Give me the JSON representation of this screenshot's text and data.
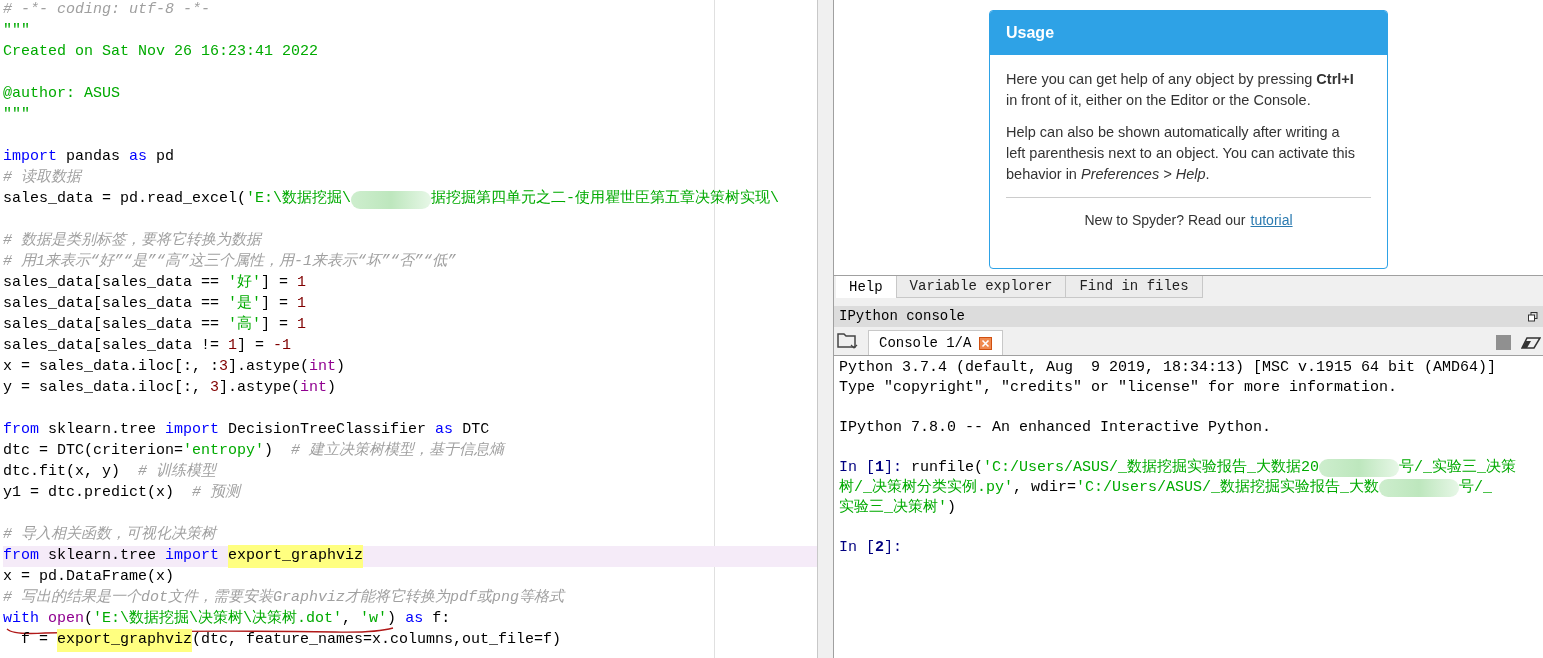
{
  "editor": {
    "lines": [
      {
        "kind": "code",
        "tokens": [
          {
            "kind": "comment",
            "text": "# -*- coding: utf-8 -*-"
          }
        ]
      },
      {
        "kind": "code",
        "tokens": [
          {
            "kind": "str",
            "text": "\"\"\""
          }
        ]
      },
      {
        "kind": "code",
        "tokens": [
          {
            "kind": "str",
            "text": "Created on Sat Nov 26 16:23:41 2022"
          }
        ]
      },
      {
        "kind": "blank"
      },
      {
        "kind": "code",
        "tokens": [
          {
            "kind": "str",
            "text": "@author: ASUS"
          }
        ]
      },
      {
        "kind": "code",
        "tokens": [
          {
            "kind": "str",
            "text": "\"\"\""
          }
        ]
      },
      {
        "kind": "blank"
      },
      {
        "kind": "code",
        "tokens": [
          {
            "kind": "kw",
            "text": "import"
          },
          {
            "kind": "plain",
            "text": " pandas "
          },
          {
            "kind": "kw",
            "text": "as"
          },
          {
            "kind": "plain",
            "text": " pd"
          }
        ]
      },
      {
        "kind": "code",
        "tokens": [
          {
            "kind": "comment",
            "text": "# 读取数据"
          }
        ]
      },
      {
        "kind": "code",
        "tokens": [
          {
            "kind": "plain",
            "text": "sales_data = pd.read_excel("
          },
          {
            "kind": "str",
            "text": "'E:\\数据挖掘\\"
          },
          {
            "kind": "redacted"
          },
          {
            "kind": "str",
            "text": "据挖掘第四单元之二-使用瞿世臣第五章决策树实现\\"
          }
        ]
      },
      {
        "kind": "blank"
      },
      {
        "kind": "code",
        "tokens": [
          {
            "kind": "comment",
            "text": "# 数据是类别标签，要将它转换为数据"
          }
        ]
      },
      {
        "kind": "code",
        "tokens": [
          {
            "kind": "comment",
            "text": "# 用1来表示“好”“是”“高”这三个属性，用-1来表示“坏”“否”“低”"
          }
        ]
      },
      {
        "kind": "code",
        "tokens": [
          {
            "kind": "plain",
            "text": "sales_data[sales_data == "
          },
          {
            "kind": "str",
            "text": "'好'"
          },
          {
            "kind": "plain",
            "text": "] = "
          },
          {
            "kind": "num",
            "text": "1"
          }
        ]
      },
      {
        "kind": "code",
        "tokens": [
          {
            "kind": "plain",
            "text": "sales_data[sales_data == "
          },
          {
            "kind": "str",
            "text": "'是'"
          },
          {
            "kind": "plain",
            "text": "] = "
          },
          {
            "kind": "num",
            "text": "1"
          }
        ]
      },
      {
        "kind": "code",
        "tokens": [
          {
            "kind": "plain",
            "text": "sales_data[sales_data == "
          },
          {
            "kind": "str",
            "text": "'高'"
          },
          {
            "kind": "plain",
            "text": "] = "
          },
          {
            "kind": "num",
            "text": "1"
          }
        ]
      },
      {
        "kind": "code",
        "tokens": [
          {
            "kind": "plain",
            "text": "sales_data[sales_data != "
          },
          {
            "kind": "num",
            "text": "1"
          },
          {
            "kind": "plain",
            "text": "] = "
          },
          {
            "kind": "num",
            "text": "-1"
          }
        ]
      },
      {
        "kind": "code",
        "tokens": [
          {
            "kind": "plain",
            "text": "x = sales_data.iloc[:, :"
          },
          {
            "kind": "num",
            "text": "3"
          },
          {
            "kind": "plain",
            "text": "].astype("
          },
          {
            "kind": "builtin",
            "text": "int"
          },
          {
            "kind": "plain",
            "text": ")"
          }
        ]
      },
      {
        "kind": "code",
        "tokens": [
          {
            "kind": "plain",
            "text": "y = sales_data.iloc[:, "
          },
          {
            "kind": "num",
            "text": "3"
          },
          {
            "kind": "plain",
            "text": "].astype("
          },
          {
            "kind": "builtin",
            "text": "int"
          },
          {
            "kind": "plain",
            "text": ")"
          }
        ]
      },
      {
        "kind": "blank"
      },
      {
        "kind": "code",
        "tokens": [
          {
            "kind": "kw",
            "text": "from"
          },
          {
            "kind": "plain",
            "text": " sklearn.tree "
          },
          {
            "kind": "kw",
            "text": "import"
          },
          {
            "kind": "plain",
            "text": " DecisionTreeClassifier "
          },
          {
            "kind": "kw",
            "text": "as"
          },
          {
            "kind": "plain",
            "text": " DTC"
          }
        ]
      },
      {
        "kind": "code",
        "tokens": [
          {
            "kind": "plain",
            "text": "dtc = DTC(criterion="
          },
          {
            "kind": "str",
            "text": "'entropy'"
          },
          {
            "kind": "plain",
            "text": ")  "
          },
          {
            "kind": "comment",
            "text": "# 建立决策树模型，基于信息熵"
          }
        ]
      },
      {
        "kind": "code",
        "tokens": [
          {
            "kind": "plain",
            "text": "dtc.fit(x, y)  "
          },
          {
            "kind": "comment",
            "text": "# 训练模型"
          }
        ]
      },
      {
        "kind": "code",
        "tokens": [
          {
            "kind": "plain",
            "text": "y1 = dtc.predict(x)  "
          },
          {
            "kind": "comment",
            "text": "# 预测"
          }
        ]
      },
      {
        "kind": "blank"
      },
      {
        "kind": "code",
        "tokens": [
          {
            "kind": "comment",
            "text": "# 导入相关函数，可视化决策树"
          }
        ]
      },
      {
        "kind": "code",
        "current": true,
        "tokens": [
          {
            "kind": "kw",
            "text": "from"
          },
          {
            "kind": "plain",
            "text": " sklearn.tree "
          },
          {
            "kind": "kw",
            "text": "import "
          },
          {
            "kind": "hl",
            "text": "export_graphviz"
          }
        ]
      },
      {
        "kind": "code",
        "tokens": [
          {
            "kind": "plain",
            "text": "x = pd.DataFrame(x)"
          }
        ]
      },
      {
        "kind": "code",
        "tokens": [
          {
            "kind": "comment",
            "text": "# 写出的结果是一个dot文件，需要安装Graphviz才能将它转换为pdf或png等格式"
          }
        ]
      },
      {
        "kind": "code",
        "underlined": true,
        "tokens": [
          {
            "kind": "kw",
            "text": "with "
          },
          {
            "kind": "builtin",
            "text": "open"
          },
          {
            "kind": "plain",
            "text": "("
          },
          {
            "kind": "str",
            "text": "'E:\\数据挖掘\\决策树\\决策树.dot'"
          },
          {
            "kind": "plain",
            "text": ", "
          },
          {
            "kind": "str",
            "text": "'w'"
          },
          {
            "kind": "plain",
            "text": ") "
          },
          {
            "kind": "kw",
            "text": "as"
          },
          {
            "kind": "plain",
            "text": " f:"
          }
        ]
      },
      {
        "kind": "code",
        "tokens": [
          {
            "kind": "plain",
            "text": "  f = "
          },
          {
            "kind": "hl",
            "text": "export_graphviz"
          },
          {
            "kind": "plain",
            "text": "(dtc, feature_names=x.columns,out_file=f)"
          }
        ]
      }
    ]
  },
  "help": {
    "card": {
      "title": "Usage",
      "paragraphs": [
        "Here you can get help of any object by pressing **Ctrl+I** in front of it, either on the Editor or the Console.",
        "Help can also be shown automatically after writing a left parenthesis next to an object. You can activate this behavior in *Preferences > Help*."
      ],
      "footer": "New to Spyder? Read our",
      "link": "tutorial"
    },
    "tabs": [
      {
        "label": "Help",
        "selected": true
      },
      {
        "label": "Variable explorer",
        "selected": false
      },
      {
        "label": "Find in files",
        "selected": false
      }
    ]
  },
  "console": {
    "title": "IPython console",
    "tabs": [
      {
        "label": "Console 1/A",
        "selected": true
      }
    ],
    "lines": [
      {
        "kind": "code",
        "tokens": [
          {
            "kind": "plain",
            "text": "Python 3.7.4 (default, Aug  9 2019, 18:34:13) [MSC v.1915 64 bit (AMD64)]"
          }
        ]
      },
      {
        "kind": "code",
        "tokens": [
          {
            "kind": "plain",
            "text": "Type \"copyright\", \"credits\" or \"license\" for more information."
          }
        ]
      },
      {
        "kind": "blank"
      },
      {
        "kind": "code",
        "tokens": [
          {
            "kind": "plain",
            "text": "IPython 7.8.0 -- An enhanced Interactive Python."
          }
        ]
      },
      {
        "kind": "blank"
      },
      {
        "kind": "code",
        "tokens": [
          {
            "kind": "prompt",
            "text": "In ["
          },
          {
            "kind": "promptnum",
            "text": "1"
          },
          {
            "kind": "prompt",
            "text": "]: "
          },
          {
            "kind": "plain",
            "text": "runfile("
          },
          {
            "kind": "str",
            "text": "'C:/Users/ASUS/_数据挖掘实验报告_大数据20"
          },
          {
            "kind": "redacted"
          },
          {
            "kind": "str",
            "text": "号/_实验三_决策"
          }
        ]
      },
      {
        "kind": "code",
        "tokens": [
          {
            "kind": "str",
            "text": "树/_决策树分类实例.py'"
          },
          {
            "kind": "plain",
            "text": ", wdir="
          },
          {
            "kind": "str",
            "text": "'C:/Users/ASUS/_数据挖掘实验报告_大数"
          },
          {
            "kind": "redacted"
          },
          {
            "kind": "str",
            "text": "号/_"
          }
        ]
      },
      {
        "kind": "code",
        "tokens": [
          {
            "kind": "str",
            "text": "实验三_决策树'"
          },
          {
            "kind": "plain",
            "text": ")"
          }
        ]
      },
      {
        "kind": "blank"
      },
      {
        "kind": "code",
        "tokens": [
          {
            "kind": "prompt",
            "text": "In ["
          },
          {
            "kind": "promptnum",
            "text": "2"
          },
          {
            "kind": "prompt",
            "text": "]: "
          }
        ]
      }
    ]
  }
}
